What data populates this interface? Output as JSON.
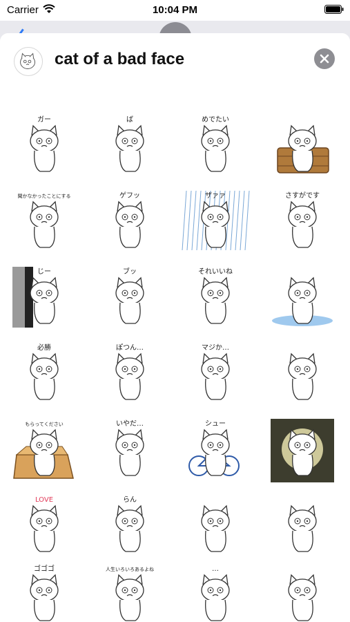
{
  "status_bar": {
    "carrier": "Carrier",
    "time": "10:04 PM"
  },
  "sheet": {
    "title": "cat of a bad face",
    "icon": "sticker-pack-icon",
    "close_icon": "close-icon"
  },
  "stickers": [
    {
      "name": "sticker-cat-lying-spread",
      "caption": "ガー",
      "bg": "none"
    },
    {
      "name": "sticker-cat-stretching",
      "caption": "ば",
      "bg": "none"
    },
    {
      "name": "sticker-cat-omedetai",
      "caption": "めでたい",
      "bg": "none"
    },
    {
      "name": "sticker-cat-bath-tub",
      "caption": "",
      "bg": "tub"
    },
    {
      "name": "sticker-cat-kikanakatta",
      "caption": "聞かなかったことにする",
      "bg": "none"
    },
    {
      "name": "sticker-cat-lying-smoke",
      "caption": "ゲフッ",
      "bg": "none"
    },
    {
      "name": "sticker-cat-rain",
      "caption": "ザァァ",
      "bg": "rain"
    },
    {
      "name": "sticker-cat-sasuga-desu",
      "caption": "さすがです",
      "bg": "none"
    },
    {
      "name": "sticker-cat-peeking-wall",
      "caption": "じー",
      "bg": "wall"
    },
    {
      "name": "sticker-cat-fart",
      "caption": "ブッ",
      "bg": "none"
    },
    {
      "name": "sticker-cat-sore-iine",
      "caption": "それいいね",
      "bg": "none"
    },
    {
      "name": "sticker-cat-crying-puddle",
      "caption": "",
      "bg": "puddle"
    },
    {
      "name": "sticker-cat-hisshou",
      "caption": "必勝",
      "bg": "none"
    },
    {
      "name": "sticker-cat-potsun",
      "caption": "ぽつん…",
      "bg": "none"
    },
    {
      "name": "sticker-cat-maji-ka",
      "caption": "マジか…",
      "bg": "none"
    },
    {
      "name": "sticker-cat-leaves-wind",
      "caption": "",
      "bg": "none"
    },
    {
      "name": "sticker-cat-box-morattekudasai",
      "caption": "もらってください",
      "bg": "box"
    },
    {
      "name": "sticker-cat-iyada",
      "caption": "いやだ…",
      "bg": "none"
    },
    {
      "name": "sticker-cat-bicycle",
      "caption": "シュー",
      "bg": "bike"
    },
    {
      "name": "sticker-cat-dark-portrait",
      "caption": "",
      "bg": "dark"
    },
    {
      "name": "sticker-cat-love-scarf",
      "caption": "LOVE",
      "bg": "none"
    },
    {
      "name": "sticker-cat-dancing",
      "caption": "らん",
      "bg": "none"
    },
    {
      "name": "sticker-cat-basket-bandana",
      "caption": "",
      "bg": "none"
    },
    {
      "name": "sticker-cat-guitar",
      "caption": "",
      "bg": "none"
    },
    {
      "name": "sticker-cat-gogo",
      "caption": "ゴゴゴ",
      "bg": "none"
    },
    {
      "name": "sticker-cat-jinsei-iroiro",
      "caption": "人生いろいろあるよね",
      "bg": "none"
    },
    {
      "name": "sticker-cat-ellipsis",
      "caption": "…",
      "bg": "none"
    },
    {
      "name": "sticker-cat-toilet",
      "caption": "",
      "bg": "none"
    }
  ]
}
